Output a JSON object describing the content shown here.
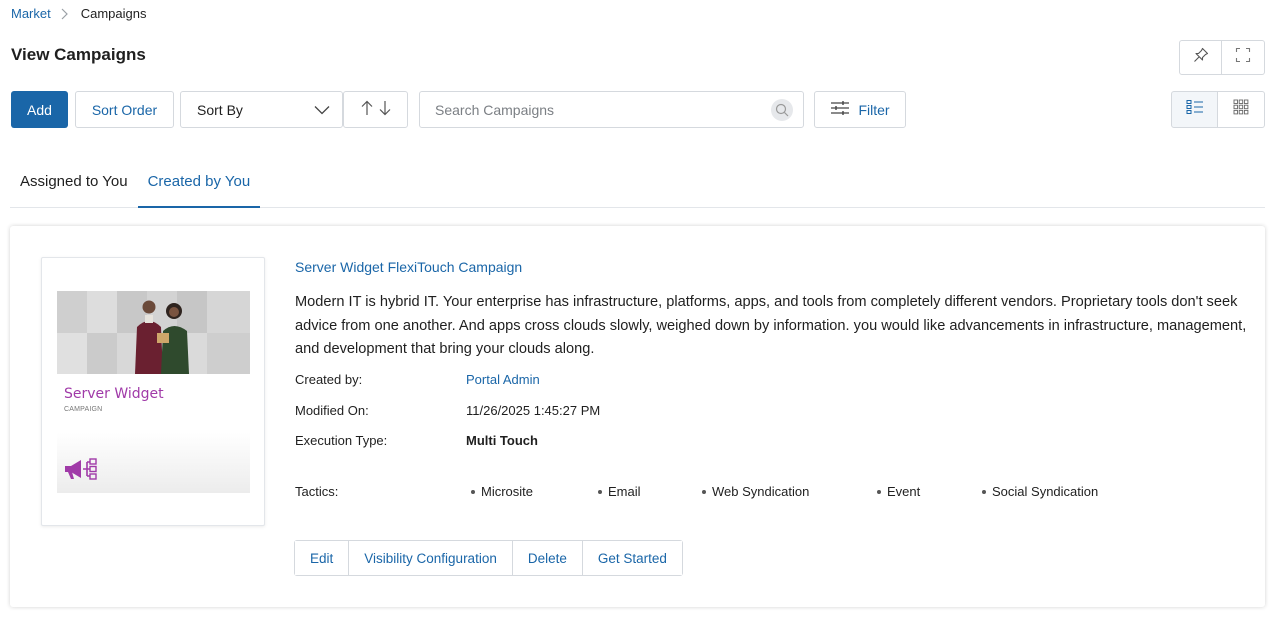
{
  "breadcrumb": {
    "parent": "Market",
    "current": "Campaigns"
  },
  "page": {
    "title": "View Campaigns"
  },
  "toolbar": {
    "add_label": "Add",
    "sort_order_label": "Sort Order",
    "sort_by_label": "Sort By",
    "search_placeholder": "Search Campaigns",
    "filter_label": "Filter"
  },
  "tabs": [
    {
      "label": "Assigned to You",
      "active": false
    },
    {
      "label": "Created by You",
      "active": true
    }
  ],
  "campaign": {
    "title": "Server Widget FlexiTouch Campaign",
    "description": "Modern IT is hybrid IT. Your enterprise has infrastructure, platforms, apps, and tools from completely different vendors. Proprietary tools don't seek advice from one another. And apps cross clouds slowly, weighed down by information. you would like advancements in infrastructure, management, and development that bring your clouds along.",
    "thumbnail": {
      "title": "Server Widget",
      "subtitle": "CAMPAIGN"
    },
    "meta": {
      "created_by_label": "Created by:",
      "created_by_value": "Portal Admin",
      "modified_on_label": "Modified On:",
      "modified_on_value": "11/26/2025 1:45:27 PM",
      "execution_type_label": "Execution Type:",
      "execution_type_value": "Multi Touch",
      "tactics_label": "Tactics:"
    },
    "tactics": [
      "Microsite",
      "Email",
      "Web Syndication",
      "Event",
      "Social Syndication"
    ],
    "actions": [
      "Edit",
      "Visibility Configuration",
      "Delete",
      "Get Started"
    ]
  },
  "colors": {
    "accent": "#1a66a8",
    "thumb_title": "#a03aa8",
    "border": "#d5d9de"
  }
}
